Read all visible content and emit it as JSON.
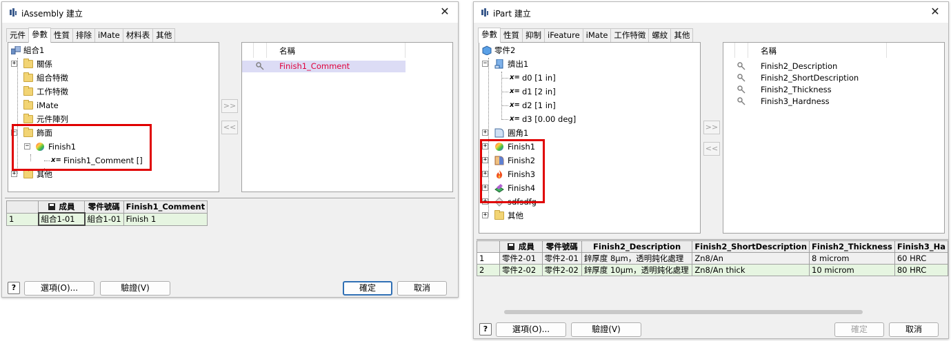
{
  "dialog_assembly": {
    "title": "iAssembly 建立",
    "close": "✕",
    "tabs": [
      "元件",
      "參數",
      "性質",
      "排除",
      "iMate",
      "材料表",
      "其他"
    ],
    "active_tab": 1,
    "tree": {
      "root": "組合1",
      "items": [
        "關係",
        "組合特徵",
        "工作特徵",
        "iMate",
        "元件陣列",
        "飾面",
        "Finish1",
        "Finish1_Comment []",
        "其他"
      ]
    },
    "selected_header": "名稱",
    "selected_items": [
      "Finish1_Comment"
    ],
    "move_right": ">>",
    "move_left": "<<",
    "table": {
      "headers": [
        "",
        "成員",
        "零件號碼",
        "Finish1_Comment"
      ],
      "rows": [
        [
          "1",
          "組合1-01",
          "組合1-01",
          "Finish 1"
        ]
      ]
    },
    "buttons": {
      "help": "?",
      "options": "選項(O)...",
      "verify": "驗證(V)",
      "ok": "確定",
      "cancel": "取消"
    }
  },
  "dialog_part": {
    "title": "iPart 建立",
    "close": "✕",
    "tabs": [
      "參數",
      "性質",
      "抑制",
      "iFeature",
      "iMate",
      "工作特徵",
      "螺紋",
      "其他"
    ],
    "active_tab": 0,
    "tree": {
      "root": "零件2",
      "items": [
        "擠出1",
        "d0 [1 in]",
        "d1 [2 in]",
        "d2 [1 in]",
        "d3 [0.00 deg]",
        "圓角1",
        "Finish1",
        "Finish2",
        "Finish3",
        "Finish4",
        "sdfsdfg",
        "其他"
      ]
    },
    "selected_header": "名稱",
    "selected_items": [
      "Finish2_Description",
      "Finish2_ShortDescription",
      "Finish2_Thickness",
      "Finish3_Hardness"
    ],
    "move_right": ">>",
    "move_left": "<<",
    "table": {
      "headers": [
        "",
        "成員",
        "零件號碼",
        "Finish2_Description",
        "Finish2_ShortDescription",
        "Finish2_Thickness",
        "Finish3_Ha"
      ],
      "rows": [
        [
          "1",
          "零件2-01",
          "零件2-01",
          "鋅厚度 8µm，透明鈍化處理",
          "Zn8/An",
          "8 microm",
          "60 HRC"
        ],
        [
          "2",
          "零件2-02",
          "零件2-02",
          "鋅厚度 10µm，透明鈍化處理",
          "Zn8/An thick",
          "10 microm",
          "80 HRC"
        ]
      ]
    },
    "buttons": {
      "help": "?",
      "options": "選項(O)...",
      "verify": "驗證(V)",
      "ok": "確定",
      "cancel": "取消"
    }
  },
  "colors": {
    "highlight": "#e00000",
    "selected_row": "#e6f5e1",
    "selected_list": "#dcdcf5",
    "list_text_red": "#e0003c"
  }
}
